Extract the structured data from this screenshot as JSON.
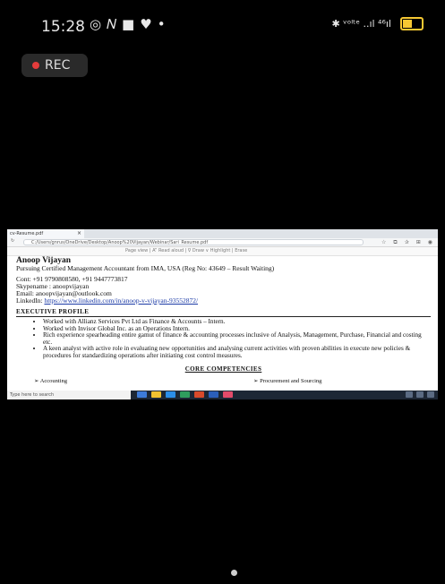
{
  "status_bar": {
    "time": "15:28",
    "left_icons": [
      "whatsapp-icon",
      "n-icon",
      "video-icon",
      "heart-icon",
      "dot-icon"
    ],
    "right_text": "✱ ᵛᵒˡᵗᵉ ..ıl ⁴⁶ıl"
  },
  "recording": {
    "label": "REC"
  },
  "browser": {
    "tab_title": "cv-Resume.pdf",
    "url": "C:/Users/gnrus/OneDrive/Desktop/Anoop%20Vijayan/Webinar/Sari_Resume.pdf",
    "pdf_toolbar": "Page view   |   A” Read aloud   |   ∇ Draw   ∨   Highlight   |   Erase"
  },
  "resume": {
    "name": "Anoop Vijayan",
    "subtitle": "Pursuing Certified Management Accountant from IMA, USA (Reg No: 43649 – Result Waiting)",
    "cont": "Cont: +91 9790808580, +91 9447773817",
    "skype": "Skypename : anoopvijayan",
    "email": "Email: anoopvijayan@outlook.com",
    "linkedin_label": "LinkedIn: ",
    "linkedin_url": "https://www.linkedin.com/in/anoop-v-vijayan-93552872/",
    "section_title": "EXECUTIVE PROFILE",
    "bullets": [
      "Worked with Allianz Services Pvt Ltd as Finance & Accounts – Intern.",
      "Worked with Invisor Global Inc. as an Operations Intern.",
      "Rich experience spearheading entire gamut of finance & accounting processes inclusive of Analysis, Management, Purchase, Financial and costing etc.",
      "A keen analyst with active role in evaluating new opportunities and analysing current activities with proven abilities in execute new policies & procedures for standardizing operations after initiating cost control measures."
    ],
    "core_title": "CORE COMPETENCIES",
    "core_left": "Accounting",
    "core_right": "Procurement and Sourcing"
  },
  "taskbar": {
    "search_placeholder": "Type here to search"
  },
  "colors": {
    "rec_dot": "#e43c3c",
    "battery": "#f6c833",
    "link": "#1a39a6",
    "taskbar": "#1d2735"
  }
}
